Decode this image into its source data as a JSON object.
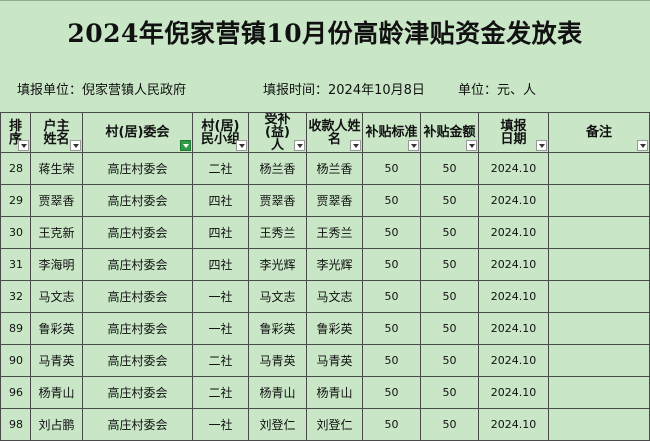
{
  "title": "2024年倪家营镇10月份高龄津贴资金发放表",
  "info": {
    "unit": "填报单位：倪家营镇人民政府",
    "date": "填报时间：2024年10月8日",
    "measure": "单位：元、人"
  },
  "headers": {
    "idx": "排序",
    "name": "户主姓名",
    "village": "村(居)委会",
    "group": "村(居)民小组",
    "recipient": "受补(益)人",
    "payee": "收款人姓名",
    "subsidy_std": "补贴标准",
    "subsidy_amt": "补贴金额",
    "date": "填报日期",
    "note": "备注"
  },
  "rows": [
    {
      "idx": "28",
      "name": "蒋生荣",
      "village": "高庄村委会",
      "group": "二社",
      "recipient": "杨兰香",
      "payee": "杨兰香",
      "std": "50",
      "amt": "50",
      "date": "2024.10",
      "note": ""
    },
    {
      "idx": "29",
      "name": "贾翠香",
      "village": "高庄村委会",
      "group": "四社",
      "recipient": "贾翠香",
      "payee": "贾翠香",
      "std": "50",
      "amt": "50",
      "date": "2024.10",
      "note": ""
    },
    {
      "idx": "30",
      "name": "王克新",
      "village": "高庄村委会",
      "group": "四社",
      "recipient": "王秀兰",
      "payee": "王秀兰",
      "std": "50",
      "amt": "50",
      "date": "2024.10",
      "note": ""
    },
    {
      "idx": "31",
      "name": "李海明",
      "village": "高庄村委会",
      "group": "四社",
      "recipient": "李光辉",
      "payee": "李光辉",
      "std": "50",
      "amt": "50",
      "date": "2024.10",
      "note": ""
    },
    {
      "idx": "32",
      "name": "马文志",
      "village": "高庄村委会",
      "group": "一社",
      "recipient": "马文志",
      "payee": "马文志",
      "std": "50",
      "amt": "50",
      "date": "2024.10",
      "note": ""
    },
    {
      "idx": "89",
      "name": "鲁彩英",
      "village": "高庄村委会",
      "group": "一社",
      "recipient": "鲁彩英",
      "payee": "鲁彩英",
      "std": "50",
      "amt": "50",
      "date": "2024.10",
      "note": ""
    },
    {
      "idx": "90",
      "name": "马青英",
      "village": "高庄村委会",
      "group": "二社",
      "recipient": "马青英",
      "payee": "马青英",
      "std": "50",
      "amt": "50",
      "date": "2024.10",
      "note": ""
    },
    {
      "idx": "96",
      "name": "杨青山",
      "village": "高庄村委会",
      "group": "二社",
      "recipient": "杨青山",
      "payee": "杨青山",
      "std": "50",
      "amt": "50",
      "date": "2024.10",
      "note": ""
    },
    {
      "idx": "98",
      "name": "刘占鹏",
      "village": "高庄村委会",
      "group": "一社",
      "recipient": "刘登仁",
      "payee": "刘登仁",
      "std": "50",
      "amt": "50",
      "date": "2024.10",
      "note": ""
    }
  ],
  "colors": {
    "sheet_background": "#c9e7c7",
    "filter_active": "#2f9c47"
  }
}
